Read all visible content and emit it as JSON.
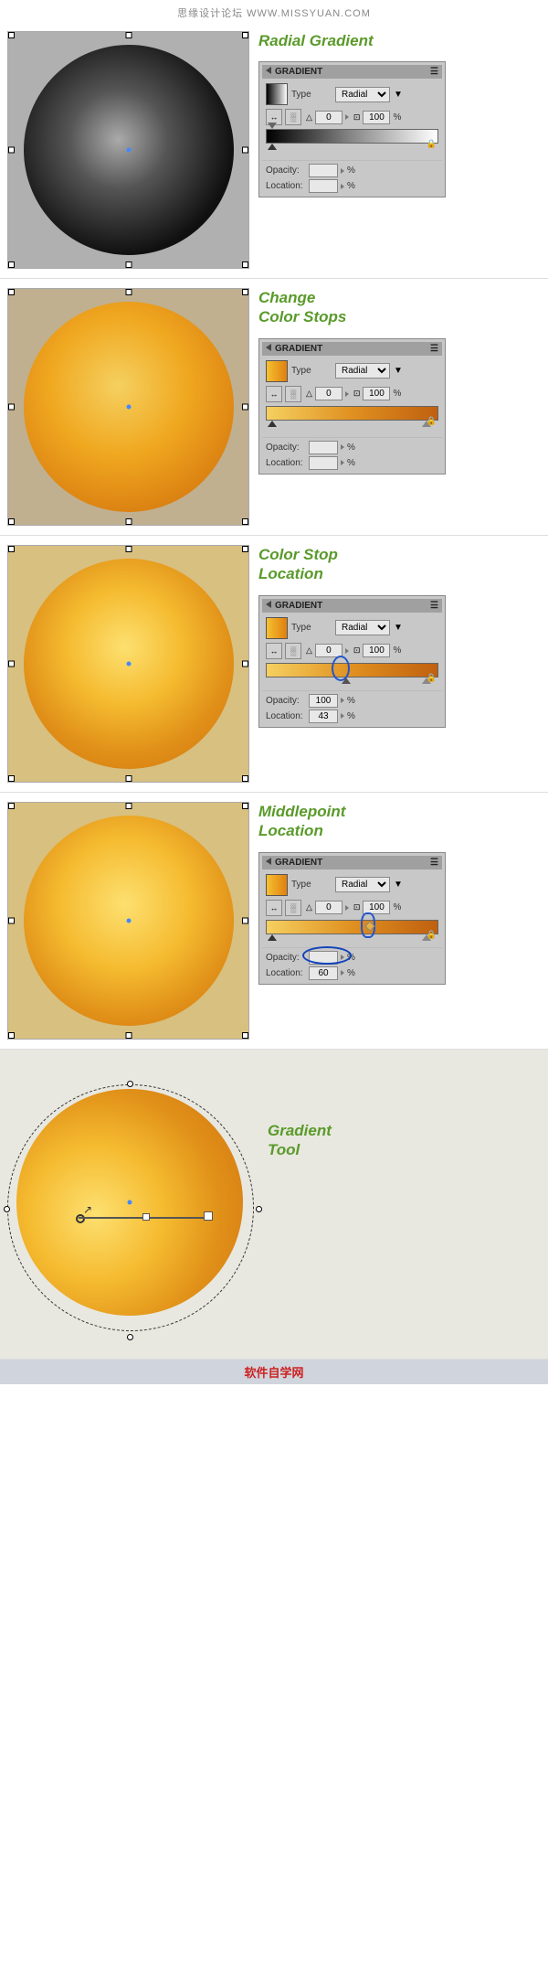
{
  "watermark": "思缘设计论坛  WWW.MISSYUAN.COM",
  "bottom_watermark": "软件自学网",
  "sections": [
    {
      "id": "section1",
      "title": "Radial Gradient",
      "panel": {
        "header": "GRADIENT",
        "type_label": "Type",
        "type_value": "Radial",
        "angle_value": "0",
        "scale_value": "100",
        "opacity_label": "Opacity:",
        "opacity_value": "",
        "location_label": "Location:",
        "location_value": ""
      }
    },
    {
      "id": "section2",
      "title": "Change\nColor Stops",
      "panel": {
        "header": "GRADIENT",
        "type_label": "Type",
        "type_value": "Radial",
        "angle_value": "0",
        "scale_value": "100",
        "opacity_label": "Opacity:",
        "opacity_value": "",
        "location_label": "Location:",
        "location_value": ""
      }
    },
    {
      "id": "section3",
      "title": "Color Stop\nLocation",
      "panel": {
        "header": "GRADIENT",
        "type_label": "Type",
        "type_value": "Radial",
        "angle_value": "0",
        "scale_value": "100",
        "opacity_label": "Opacity:",
        "opacity_value": "100",
        "location_label": "Location:",
        "location_value": "43"
      }
    },
    {
      "id": "section4",
      "title": "Middlepoint\nLocation",
      "panel": {
        "header": "GRADIENT",
        "type_label": "Type",
        "type_value": "Radial",
        "angle_value": "0",
        "scale_value": "100",
        "opacity_label": "Opacity:",
        "opacity_value": "",
        "location_label": "Location:",
        "location_value": "60"
      }
    },
    {
      "id": "section5",
      "title": "Gradient\nTool"
    }
  ]
}
